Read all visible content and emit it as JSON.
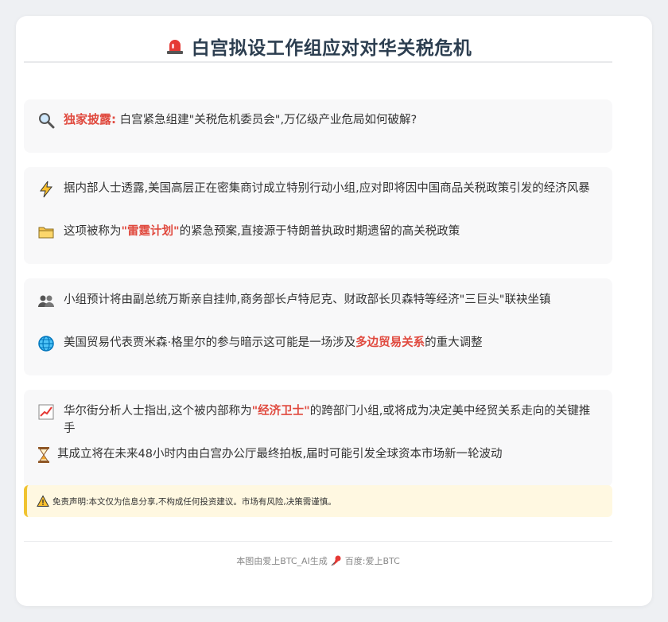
{
  "header": {
    "title": "白宫拟设工作组应对对华关税危机"
  },
  "section1": {
    "lead_label": "独家披露:",
    "lead_text": "白宫紧急组建\"关税危机委员会\",万亿级产业危局如何破解?"
  },
  "section2": {
    "item1": "据内部人士透露,美国高层正在密集商讨成立特别行动小组,应对即将因中国商品关税政策引发的经济风暴",
    "item2_pre": "这项被称为",
    "item2_hl": "\"雷霆计划\"",
    "item2_post": "的紧急预案,直接源于特朗普执政时期遗留的高关税政策"
  },
  "section3": {
    "item1": "小组预计将由副总统万斯亲自挂帅,商务部长卢特尼克、财政部长贝森特等经济\"三巨头\"联袂坐镇",
    "item2_pre": "美国贸易代表贾米森·格里尔的参与暗示这可能是一场涉及",
    "item2_hl": "多边贸易关系",
    "item2_post": "的重大调整"
  },
  "section4": {
    "item1_pre": "华尔街分析人士指出,这个被内部称为",
    "item1_hl": "\"经济卫士\"",
    "item1_post": "的跨部门小组,或将成为决定美中经贸关系走向的关键推手",
    "item2": "其成立将在未来48小时内由白宫办公厅最终拍板,届时可能引发全球资本市场新一轮波动"
  },
  "disclaimer": {
    "text": "免责声明:本文仅为信息分享,不构成任何投资建议。市场有风险,决策需谨慎。"
  },
  "footer": {
    "left": "本图由爱上BTC_AI生成",
    "right": "百度:爱上BTC"
  },
  "icons": {
    "title": "siren-icon",
    "s1": "magnifier-icon",
    "s2a": "lightning-icon",
    "s2b": "folder-icon",
    "s3a": "people-icon",
    "s3b": "globe-icon",
    "s4a": "chart-up-icon",
    "s4b": "hourglass-icon",
    "disclaimer": "warning-icon",
    "footer": "pushpin-icon"
  },
  "colors": {
    "highlight": "#e04a3f",
    "title": "#2c3e50",
    "disclaimer_bg": "#fff8e1",
    "disclaimer_border": "#f0c330"
  }
}
